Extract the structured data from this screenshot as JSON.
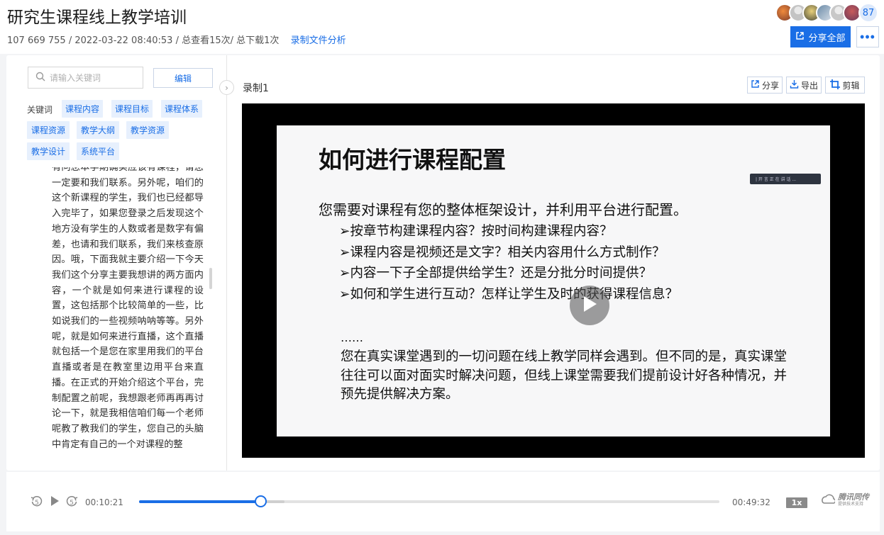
{
  "header": {
    "title": "研究生课程线上教学培训",
    "meeting_id": "107 669 755",
    "datetime": "/ 2022-03-22 08:40:53",
    "stats": "/ 总查看15次/ 总下载1次",
    "analysis_link": "录制文件分析",
    "viewer_count": "87",
    "share_all_label": "分享全部",
    "more_label": "•••"
  },
  "sidebar": {
    "search_placeholder": "请输入关键词",
    "edit_label": "编辑",
    "keyword_label": "关键词",
    "keywords": [
      "课程内容",
      "课程目标",
      "课程体系",
      "课程资源",
      "教学大纲",
      "教学资源",
      "教学设计",
      "系统平台"
    ],
    "transcript": "有问您本学期确实应该有课程，请您一定要和我们联系。另外呢，咱们的这个新课程的学生，我们也已经都导入完毕了，如果您登录之后发现这个地方没有学生的人数或者是数字有偏差，也请和我们联系，我们来核查原因。哦，下面我就主要介绍一下今天我们这个分享主要我想讲的两方面内容，一个就是如何来进行课程的设置，这包括那个比较简单的一些，比如说我们的一些视频呐呐等等。另外呢，就是如何来进行直播，这个直播就包括一个是您在家里用我们的平台直播或者是在教室里边用平台来直播。在正式的开始介绍这个平台，完制配置之前呢，我想跟老师再再再讨论一下，就是我相信咱们每一个老师呢教了教我们的学生，您自己的头脑中肯定有自己的一个对课程的整"
  },
  "recording": {
    "title": "录制1",
    "share_label": "分享",
    "export_label": "导出",
    "clip_label": "剪辑"
  },
  "slide": {
    "title": "如何进行课程配置",
    "subtitle": "您需要对课程有您的整体框架设计，并利用平台进行配置。",
    "bullets": [
      "➢按章节构建课程内容？按时间构建课程内容？",
      "➢课程内容是视频还是文字？相关内容用什么方式制作？",
      "➢内容一下子全部提供给学生？还是分批分时间提供？",
      "➢如何和学生进行互动？怎样让学生及时的获得课程信息？"
    ],
    "ellipsis": "……",
    "paragraph": "您在真实课堂遇到的一切问题在线上教学同样会遇到。但不同的是，真实课堂往往可以面对面实时解决问题，但线上课堂需要我们提前设计好各种情况，并预先提供解决方案。",
    "overlay_text": "| 开 言 正 在 讲 话 ..."
  },
  "player": {
    "back_label": "5",
    "forward_label": "5",
    "current_time": "00:10:21",
    "total_time": "00:49:32",
    "progress": 0.209,
    "buffered": 0.25,
    "speed": "1x",
    "brand_name": "腾讯同传",
    "brand_sub": "提供技术支持"
  },
  "colors": {
    "accent": "#1a6ee6",
    "chip_bg": "#e7f0fd"
  }
}
